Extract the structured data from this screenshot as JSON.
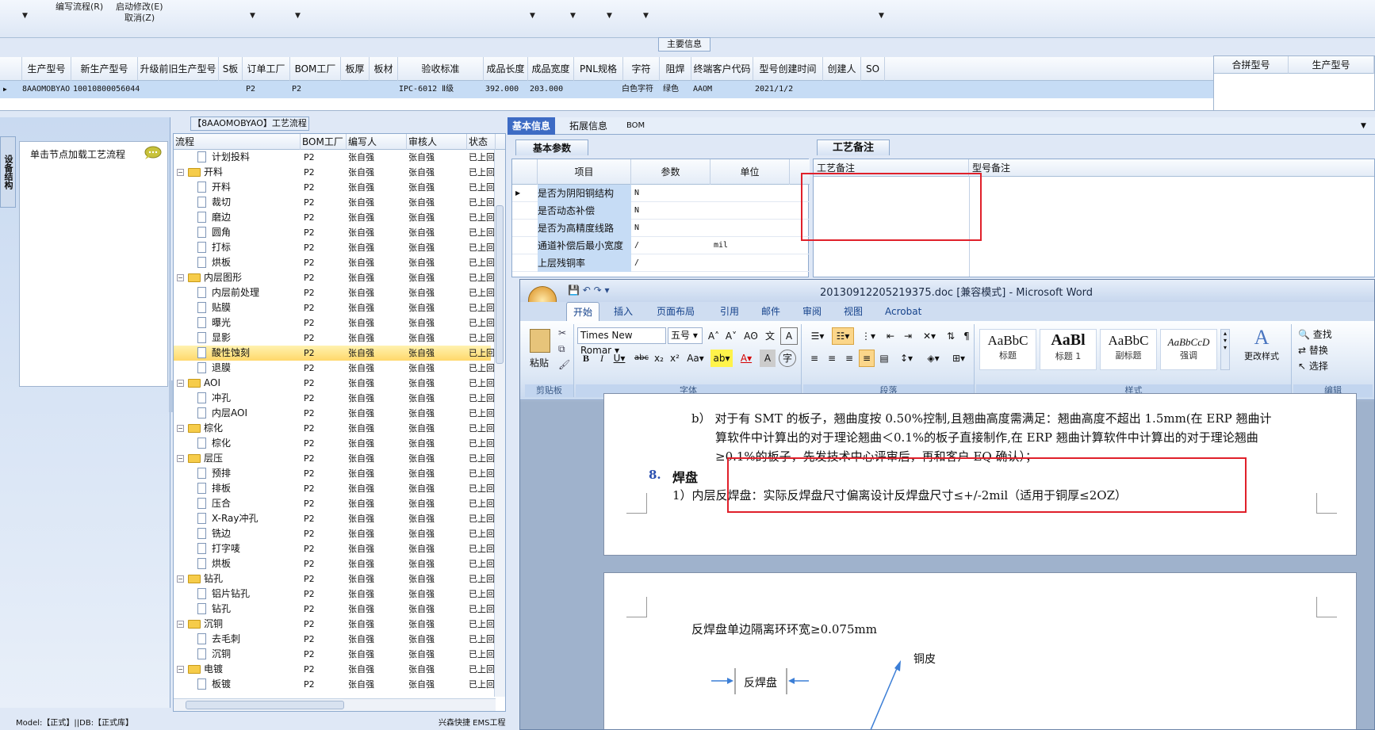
{
  "menu": {
    "edit_flow": "编写流程(R)",
    "start_modify": "启动修改(E)",
    "cancel": "取消(Z)"
  },
  "main_info": {
    "title": "主要信息",
    "headers": [
      "生产型号",
      "新生产型号",
      "升级前旧生产型号",
      "S板",
      "订单工厂",
      "BOM工厂",
      "板厚",
      "板材",
      "验收标准",
      "成品长度",
      "成品宽度",
      "PNL规格",
      "字符",
      "阻焊",
      "终端客户代码",
      "型号创建时间",
      "创建人",
      "SO"
    ],
    "row": {
      "prod_model": "8AAOMOBYAO",
      "new_model": "10010800056044",
      "order_factory": "P2",
      "bom_factory": "P2",
      "standard": "IPC-6012 Ⅱ级",
      "length": "392.000",
      "width": "203.000",
      "char": "白色字符",
      "solder": "绿色",
      "customer": "AAOM",
      "created": "2021/1/2"
    },
    "merge_headers": [
      "合拼型号",
      "生产型号"
    ]
  },
  "left_panel": {
    "tab": "设备结构",
    "node_hint": "单击节点加载工艺流程"
  },
  "process": {
    "title": "【8AAOMOBYAO】工艺流程",
    "headers": [
      "流程",
      "BOM工厂",
      "编写人",
      "审核人",
      "状态"
    ],
    "rows": [
      {
        "name": "计划投料",
        "level": 1,
        "type": "doc",
        "bom": "P2",
        "writer": "张自强",
        "reviewer": "张自强",
        "status": "已上回"
      },
      {
        "name": "开料",
        "level": 0,
        "type": "folder",
        "bom": "P2",
        "writer": "张自强",
        "reviewer": "张自强",
        "status": "已上回"
      },
      {
        "name": "开料",
        "level": 1,
        "type": "doc",
        "bom": "P2",
        "writer": "张自强",
        "reviewer": "张自强",
        "status": "已上回"
      },
      {
        "name": "裁切",
        "level": 1,
        "type": "doc",
        "bom": "P2",
        "writer": "张自强",
        "reviewer": "张自强",
        "status": "已上回"
      },
      {
        "name": "磨边",
        "level": 1,
        "type": "doc",
        "bom": "P2",
        "writer": "张自强",
        "reviewer": "张自强",
        "status": "已上回"
      },
      {
        "name": "圆角",
        "level": 1,
        "type": "doc",
        "bom": "P2",
        "writer": "张自强",
        "reviewer": "张自强",
        "status": "已上回"
      },
      {
        "name": "打标",
        "level": 1,
        "type": "doc",
        "bom": "P2",
        "writer": "张自强",
        "reviewer": "张自强",
        "status": "已上回"
      },
      {
        "name": "烘板",
        "level": 1,
        "type": "doc",
        "bom": "P2",
        "writer": "张自强",
        "reviewer": "张自强",
        "status": "已上回"
      },
      {
        "name": "内层图形",
        "level": 0,
        "type": "folder",
        "bom": "P2",
        "writer": "张自强",
        "reviewer": "张自强",
        "status": "已上回"
      },
      {
        "name": "内层前处理",
        "level": 1,
        "type": "doc",
        "bom": "P2",
        "writer": "张自强",
        "reviewer": "张自强",
        "status": "已上回"
      },
      {
        "name": "贴膜",
        "level": 1,
        "type": "doc",
        "bom": "P2",
        "writer": "张自强",
        "reviewer": "张自强",
        "status": "已上回"
      },
      {
        "name": "曝光",
        "level": 1,
        "type": "doc",
        "bom": "P2",
        "writer": "张自强",
        "reviewer": "张自强",
        "status": "已上回"
      },
      {
        "name": "显影",
        "level": 1,
        "type": "doc",
        "bom": "P2",
        "writer": "张自强",
        "reviewer": "张自强",
        "status": "已上回"
      },
      {
        "name": "酸性蚀刻",
        "level": 1,
        "type": "doc",
        "bom": "P2",
        "writer": "张自强",
        "reviewer": "张自强",
        "status": "已上回",
        "selected": true
      },
      {
        "name": "退膜",
        "level": 1,
        "type": "doc",
        "bom": "P2",
        "writer": "张自强",
        "reviewer": "张自强",
        "status": "已上回"
      },
      {
        "name": "AOI",
        "level": 0,
        "type": "folder",
        "bom": "P2",
        "writer": "张自强",
        "reviewer": "张自强",
        "status": "已上回"
      },
      {
        "name": "冲孔",
        "level": 1,
        "type": "doc",
        "bom": "P2",
        "writer": "张自强",
        "reviewer": "张自强",
        "status": "已上回"
      },
      {
        "name": "内层AOI",
        "level": 1,
        "type": "doc",
        "bom": "P2",
        "writer": "张自强",
        "reviewer": "张自强",
        "status": "已上回"
      },
      {
        "name": "棕化",
        "level": 0,
        "type": "folder",
        "bom": "P2",
        "writer": "张自强",
        "reviewer": "张自强",
        "status": "已上回"
      },
      {
        "name": "棕化",
        "level": 1,
        "type": "doc",
        "bom": "P2",
        "writer": "张自强",
        "reviewer": "张自强",
        "status": "已上回"
      },
      {
        "name": "层压",
        "level": 0,
        "type": "folder",
        "bom": "P2",
        "writer": "张自强",
        "reviewer": "张自强",
        "status": "已上回"
      },
      {
        "name": "预排",
        "level": 1,
        "type": "doc",
        "bom": "P2",
        "writer": "张自强",
        "reviewer": "张自强",
        "status": "已上回"
      },
      {
        "name": "排板",
        "level": 1,
        "type": "doc",
        "bom": "P2",
        "writer": "张自强",
        "reviewer": "张自强",
        "status": "已上回"
      },
      {
        "name": "压合",
        "level": 1,
        "type": "doc",
        "bom": "P2",
        "writer": "张自强",
        "reviewer": "张自强",
        "status": "已上回"
      },
      {
        "name": "X-Ray冲孔",
        "level": 1,
        "type": "doc",
        "bom": "P2",
        "writer": "张自强",
        "reviewer": "张自强",
        "status": "已上回"
      },
      {
        "name": "铣边",
        "level": 1,
        "type": "doc",
        "bom": "P2",
        "writer": "张自强",
        "reviewer": "张自强",
        "status": "已上回"
      },
      {
        "name": "打字唛",
        "level": 1,
        "type": "doc",
        "bom": "P2",
        "writer": "张自强",
        "reviewer": "张自强",
        "status": "已上回"
      },
      {
        "name": "烘板",
        "level": 1,
        "type": "doc",
        "bom": "P2",
        "writer": "张自强",
        "reviewer": "张自强",
        "status": "已上回"
      },
      {
        "name": "钻孔",
        "level": 0,
        "type": "folder",
        "bom": "P2",
        "writer": "张自强",
        "reviewer": "张自强",
        "status": "已上回"
      },
      {
        "name": "铝片钻孔",
        "level": 1,
        "type": "doc",
        "bom": "P2",
        "writer": "张自强",
        "reviewer": "张自强",
        "status": "已上回"
      },
      {
        "name": "钻孔",
        "level": 1,
        "type": "doc",
        "bom": "P2",
        "writer": "张自强",
        "reviewer": "张自强",
        "status": "已上回"
      },
      {
        "name": "沉铜",
        "level": 0,
        "type": "folder",
        "bom": "P2",
        "writer": "张自强",
        "reviewer": "张自强",
        "status": "已上回"
      },
      {
        "name": "去毛刺",
        "level": 1,
        "type": "doc",
        "bom": "P2",
        "writer": "张自强",
        "reviewer": "张自强",
        "status": "已上回"
      },
      {
        "name": "沉铜",
        "level": 1,
        "type": "doc",
        "bom": "P2",
        "writer": "张自强",
        "reviewer": "张自强",
        "status": "已上回"
      },
      {
        "name": "电镀",
        "level": 0,
        "type": "folder",
        "bom": "P2",
        "writer": "张自强",
        "reviewer": "张自强",
        "status": "已上回"
      },
      {
        "name": "板镀",
        "level": 1,
        "type": "doc",
        "bom": "P2",
        "writer": "张自强",
        "reviewer": "张自强",
        "status": "已上回"
      }
    ]
  },
  "right_tabs": [
    "基本信息",
    "拓展信息",
    "BOM"
  ],
  "basic_params": {
    "title": "基本参数",
    "headers": [
      "项目",
      "参数",
      "单位"
    ],
    "rows": [
      {
        "item": "是否为阴阳铜结构",
        "value": "N",
        "unit": ""
      },
      {
        "item": "是否动态补偿",
        "value": "N",
        "unit": ""
      },
      {
        "item": "是否为高精度线路",
        "value": "N",
        "unit": ""
      },
      {
        "item": "通道补偿后最小宽度",
        "value": "/",
        "unit": "mil"
      },
      {
        "item": "上层残铜率",
        "value": "/",
        "unit": ""
      }
    ]
  },
  "memo": {
    "title": "工艺备注",
    "col1": "工艺备注",
    "col2": "型号备注"
  },
  "word": {
    "title": "20130912205219375.doc [兼容模式] - Microsoft Word",
    "tabs": [
      "开始",
      "插入",
      "页面布局",
      "引用",
      "邮件",
      "审阅",
      "视图",
      "Acrobat"
    ],
    "font_name": "Times New Romar",
    "font_size": "五号",
    "groups": [
      "剪贴板",
      "字体",
      "段落",
      "样式",
      "编辑"
    ],
    "paste": "粘贴",
    "styles": [
      {
        "preview": "AaBbC",
        "name": "标题"
      },
      {
        "preview": "AaBl",
        "name": "标题 1"
      },
      {
        "preview": "AaBbC",
        "name": "副标题"
      },
      {
        "preview": "AaBbCcD",
        "name": "强调"
      }
    ],
    "change_style": "更改样式",
    "edit_items": [
      "查找",
      "替换",
      "选择"
    ],
    "doc_lines": [
      "b） 对于有 SMT 的板子，翘曲度按 0.50%控制,且翘曲高度需满足：翘曲高度不超出 1.5mm(在 ERP 翘曲计",
      "算软件中计算出的对于理论翘曲＜0.1%的板子直接制作,在 ERP 翘曲计算软件中计算出的对于理论翘曲",
      "≥0.1%的板子，先发技术中心评审后，再和客户 EQ 确认）；"
    ],
    "section_num": "8.",
    "section_title": "焊盘",
    "section_line": "1）内层反焊盘：实际反焊盘尺寸偏离设计反焊盘尺寸≤+/-2mil（适用于铜厚≤2OZ）",
    "page2_line": "反焊盘单边隔离环环宽≥0.075mm",
    "fig_label1": "反焊盘",
    "fig_label2": "铜皮"
  },
  "status_bar": {
    "left": "Model:【正式】||DB:【正式库】",
    "right": "兴森快捷 EMS工程"
  }
}
